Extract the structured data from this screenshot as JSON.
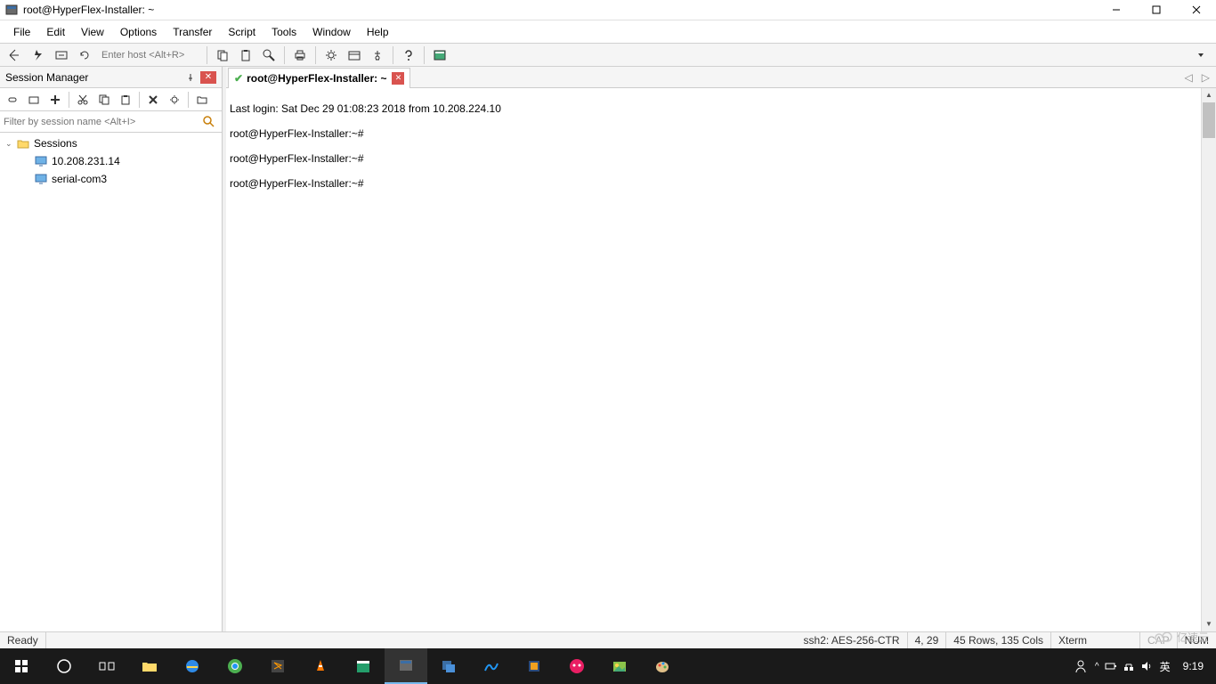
{
  "window": {
    "title": "root@HyperFlex-Installer: ~"
  },
  "menu": [
    "File",
    "Edit",
    "View",
    "Options",
    "Transfer",
    "Script",
    "Tools",
    "Window",
    "Help"
  ],
  "toolbar": {
    "enter_host_placeholder": "Enter host <Alt+R>"
  },
  "sidebar": {
    "title": "Session Manager",
    "filter_placeholder": "Filter by session name <Alt+I>",
    "root": "Sessions",
    "items": [
      "10.208.231.14",
      "serial-com3"
    ]
  },
  "tab": {
    "label": "root@HyperFlex-Installer: ~"
  },
  "terminal": {
    "lines": [
      "Last login: Sat Dec 29 01:08:23 2018 from 10.208.224.10",
      "root@HyperFlex-Installer:~#",
      "root@HyperFlex-Installer:~#",
      "root@HyperFlex-Installer:~#"
    ]
  },
  "status": {
    "ready": "Ready",
    "proto": "ssh2: AES-256-CTR",
    "pos": "4,  29",
    "size": "45 Rows, 135 Cols",
    "term": "Xterm",
    "cap": "CAP",
    "num": "NUM"
  },
  "taskbar": {
    "ime": "英",
    "time": "9:19"
  },
  "watermark": "亿速云"
}
